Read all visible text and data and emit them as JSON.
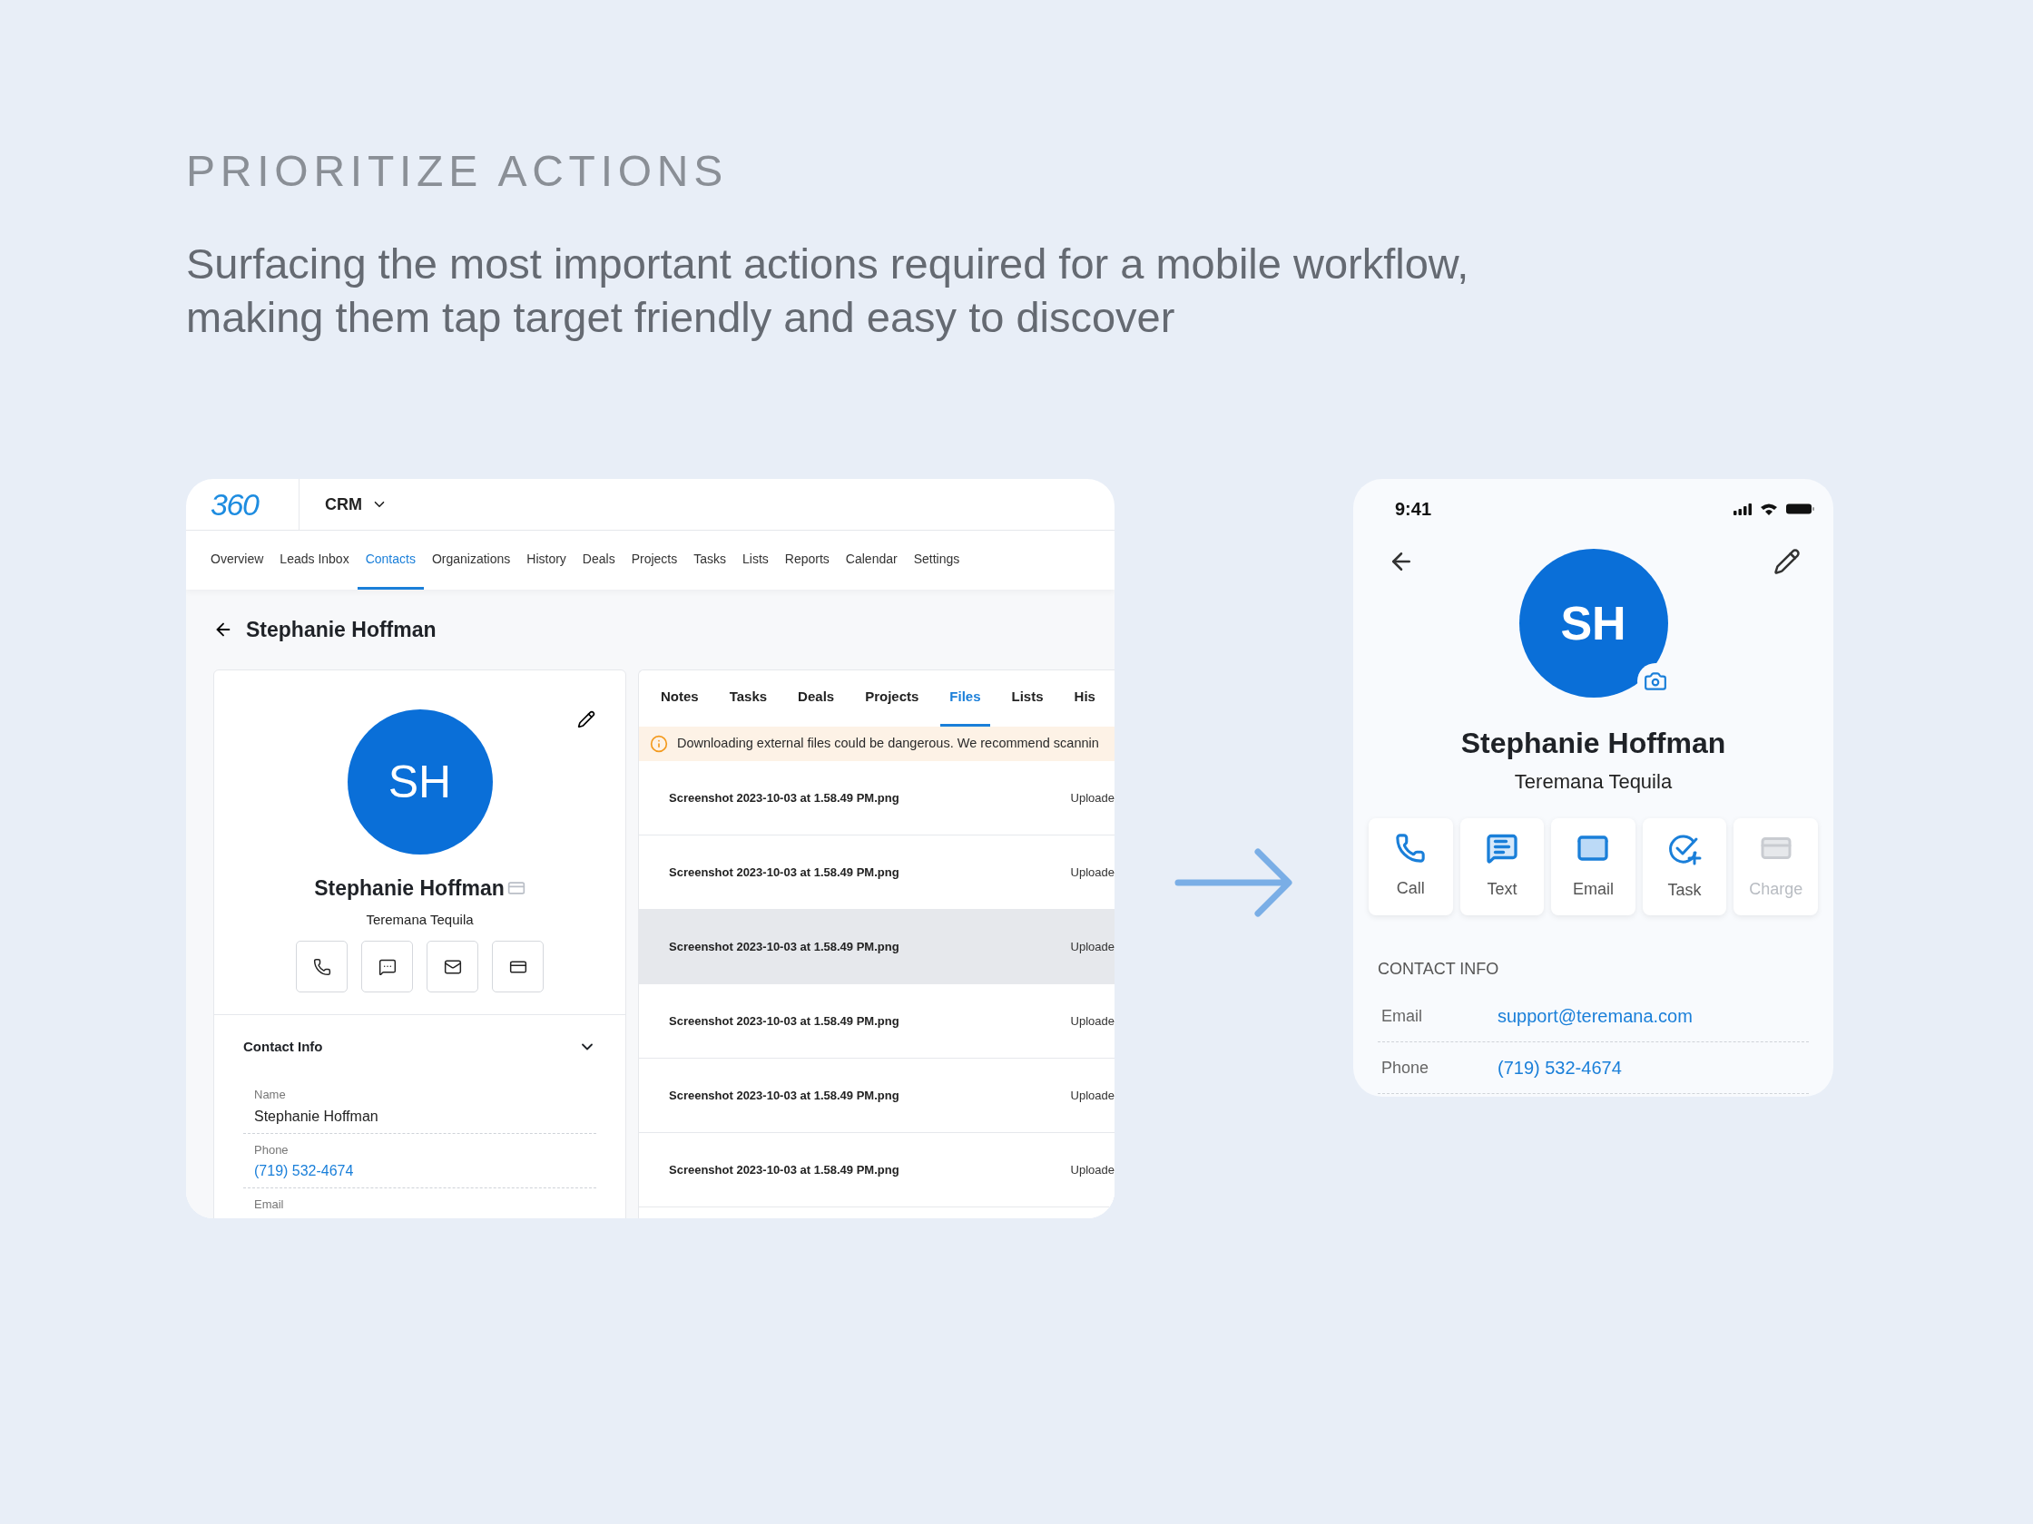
{
  "header": {
    "eyebrow": "PRIORITIZE ACTIONS",
    "description": "Surfacing the most important actions required for a mobile workflow, making them tap target friendly and easy to discover"
  },
  "desktop": {
    "logo": "360",
    "app_switcher": "CRM",
    "nav": [
      {
        "label": "Overview",
        "selected": false
      },
      {
        "label": "Leads Inbox",
        "selected": false
      },
      {
        "label": "Contacts",
        "selected": true
      },
      {
        "label": "Organizations",
        "selected": false
      },
      {
        "label": "History",
        "selected": false
      },
      {
        "label": "Deals",
        "selected": false
      },
      {
        "label": "Projects",
        "selected": false
      },
      {
        "label": "Tasks",
        "selected": false
      },
      {
        "label": "Lists",
        "selected": false
      },
      {
        "label": "Reports",
        "selected": false
      },
      {
        "label": "Calendar",
        "selected": false
      },
      {
        "label": "Settings",
        "selected": false
      }
    ],
    "page_title": "Stephanie Hoffman",
    "profile": {
      "initials": "SH",
      "name": "Stephanie Hoffman",
      "company": "Teremana Tequila",
      "actions": [
        {
          "kind": "call"
        },
        {
          "kind": "text"
        },
        {
          "kind": "email"
        },
        {
          "kind": "charge"
        }
      ]
    },
    "contact_info": {
      "title": "Contact Info",
      "expanded": true,
      "fields": [
        {
          "label": "Name",
          "value": "Stephanie Hoffman",
          "kind": "plain"
        },
        {
          "label": "Phone",
          "value": "(719) 532-4674",
          "kind": "link"
        },
        {
          "label": "Email",
          "kind": "label"
        }
      ]
    },
    "tabs": [
      {
        "label": "Notes",
        "selected": false
      },
      {
        "label": "Tasks",
        "selected": false
      },
      {
        "label": "Deals",
        "selected": false
      },
      {
        "label": "Projects",
        "selected": false
      },
      {
        "label": "Files",
        "selected": true
      },
      {
        "label": "Lists",
        "selected": false
      },
      {
        "label": "His",
        "selected": false
      }
    ],
    "warning": "Downloading external files could be dangerous. We recommend scannin",
    "files": [
      {
        "name": "Screenshot 2023-10-03 at 1.58.49 PM.png",
        "status": "Uploade",
        "selected": false
      },
      {
        "name": "Screenshot 2023-10-03 at 1.58.49 PM.png",
        "status": "Uploade",
        "selected": false
      },
      {
        "name": "Screenshot 2023-10-03 at 1.58.49 PM.png",
        "status": "Uploade",
        "selected": true
      },
      {
        "name": "Screenshot 2023-10-03 at 1.58.49 PM.png",
        "status": "Uploade",
        "selected": false
      },
      {
        "name": "Screenshot 2023-10-03 at 1.58.49 PM.png",
        "status": "Uploade",
        "selected": false
      },
      {
        "name": "Screenshot 2023-10-03 at 1.58.49 PM.png",
        "status": "Uploade",
        "selected": false
      }
    ]
  },
  "mobile": {
    "time": "9:41",
    "initials": "SH",
    "name": "Stephanie Hoffman",
    "company": "Teremana Tequila",
    "actions": [
      {
        "kind": "call",
        "label": "Call",
        "disabled": false
      },
      {
        "kind": "text",
        "label": "Text",
        "disabled": false
      },
      {
        "kind": "email",
        "label": "Email",
        "disabled": false
      },
      {
        "kind": "task",
        "label": "Task",
        "disabled": false
      },
      {
        "kind": "charge",
        "label": "Charge",
        "disabled": true
      }
    ],
    "contact_info": {
      "title": "CONTACT INFO",
      "fields": [
        {
          "label": "Email",
          "value": "support@teremana.com"
        },
        {
          "label": "Phone",
          "value": "(719) 532-4674"
        }
      ]
    }
  }
}
